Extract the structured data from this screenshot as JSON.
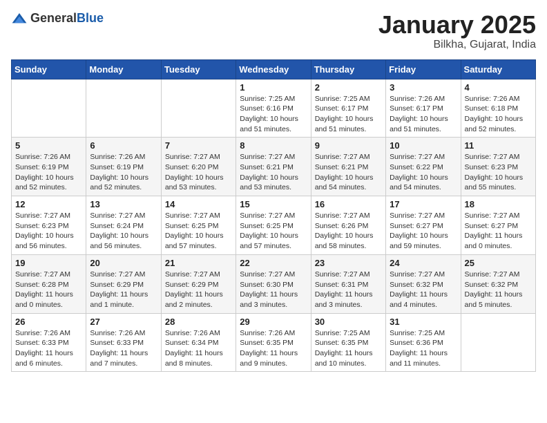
{
  "logo": {
    "general": "General",
    "blue": "Blue"
  },
  "header": {
    "month": "January 2025",
    "location": "Bilkha, Gujarat, India"
  },
  "weekdays": [
    "Sunday",
    "Monday",
    "Tuesday",
    "Wednesday",
    "Thursday",
    "Friday",
    "Saturday"
  ],
  "weeks": [
    [
      {
        "day": "",
        "info": ""
      },
      {
        "day": "",
        "info": ""
      },
      {
        "day": "",
        "info": ""
      },
      {
        "day": "1",
        "info": "Sunrise: 7:25 AM\nSunset: 6:16 PM\nDaylight: 10 hours\nand 51 minutes."
      },
      {
        "day": "2",
        "info": "Sunrise: 7:25 AM\nSunset: 6:17 PM\nDaylight: 10 hours\nand 51 minutes."
      },
      {
        "day": "3",
        "info": "Sunrise: 7:26 AM\nSunset: 6:17 PM\nDaylight: 10 hours\nand 51 minutes."
      },
      {
        "day": "4",
        "info": "Sunrise: 7:26 AM\nSunset: 6:18 PM\nDaylight: 10 hours\nand 52 minutes."
      }
    ],
    [
      {
        "day": "5",
        "info": "Sunrise: 7:26 AM\nSunset: 6:19 PM\nDaylight: 10 hours\nand 52 minutes."
      },
      {
        "day": "6",
        "info": "Sunrise: 7:26 AM\nSunset: 6:19 PM\nDaylight: 10 hours\nand 52 minutes."
      },
      {
        "day": "7",
        "info": "Sunrise: 7:27 AM\nSunset: 6:20 PM\nDaylight: 10 hours\nand 53 minutes."
      },
      {
        "day": "8",
        "info": "Sunrise: 7:27 AM\nSunset: 6:21 PM\nDaylight: 10 hours\nand 53 minutes."
      },
      {
        "day": "9",
        "info": "Sunrise: 7:27 AM\nSunset: 6:21 PM\nDaylight: 10 hours\nand 54 minutes."
      },
      {
        "day": "10",
        "info": "Sunrise: 7:27 AM\nSunset: 6:22 PM\nDaylight: 10 hours\nand 54 minutes."
      },
      {
        "day": "11",
        "info": "Sunrise: 7:27 AM\nSunset: 6:23 PM\nDaylight: 10 hours\nand 55 minutes."
      }
    ],
    [
      {
        "day": "12",
        "info": "Sunrise: 7:27 AM\nSunset: 6:23 PM\nDaylight: 10 hours\nand 56 minutes."
      },
      {
        "day": "13",
        "info": "Sunrise: 7:27 AM\nSunset: 6:24 PM\nDaylight: 10 hours\nand 56 minutes."
      },
      {
        "day": "14",
        "info": "Sunrise: 7:27 AM\nSunset: 6:25 PM\nDaylight: 10 hours\nand 57 minutes."
      },
      {
        "day": "15",
        "info": "Sunrise: 7:27 AM\nSunset: 6:25 PM\nDaylight: 10 hours\nand 57 minutes."
      },
      {
        "day": "16",
        "info": "Sunrise: 7:27 AM\nSunset: 6:26 PM\nDaylight: 10 hours\nand 58 minutes."
      },
      {
        "day": "17",
        "info": "Sunrise: 7:27 AM\nSunset: 6:27 PM\nDaylight: 10 hours\nand 59 minutes."
      },
      {
        "day": "18",
        "info": "Sunrise: 7:27 AM\nSunset: 6:27 PM\nDaylight: 11 hours\nand 0 minutes."
      }
    ],
    [
      {
        "day": "19",
        "info": "Sunrise: 7:27 AM\nSunset: 6:28 PM\nDaylight: 11 hours\nand 0 minutes."
      },
      {
        "day": "20",
        "info": "Sunrise: 7:27 AM\nSunset: 6:29 PM\nDaylight: 11 hours\nand 1 minute."
      },
      {
        "day": "21",
        "info": "Sunrise: 7:27 AM\nSunset: 6:29 PM\nDaylight: 11 hours\nand 2 minutes."
      },
      {
        "day": "22",
        "info": "Sunrise: 7:27 AM\nSunset: 6:30 PM\nDaylight: 11 hours\nand 3 minutes."
      },
      {
        "day": "23",
        "info": "Sunrise: 7:27 AM\nSunset: 6:31 PM\nDaylight: 11 hours\nand 3 minutes."
      },
      {
        "day": "24",
        "info": "Sunrise: 7:27 AM\nSunset: 6:32 PM\nDaylight: 11 hours\nand 4 minutes."
      },
      {
        "day": "25",
        "info": "Sunrise: 7:27 AM\nSunset: 6:32 PM\nDaylight: 11 hours\nand 5 minutes."
      }
    ],
    [
      {
        "day": "26",
        "info": "Sunrise: 7:26 AM\nSunset: 6:33 PM\nDaylight: 11 hours\nand 6 minutes."
      },
      {
        "day": "27",
        "info": "Sunrise: 7:26 AM\nSunset: 6:33 PM\nDaylight: 11 hours\nand 7 minutes."
      },
      {
        "day": "28",
        "info": "Sunrise: 7:26 AM\nSunset: 6:34 PM\nDaylight: 11 hours\nand 8 minutes."
      },
      {
        "day": "29",
        "info": "Sunrise: 7:26 AM\nSunset: 6:35 PM\nDaylight: 11 hours\nand 9 minutes."
      },
      {
        "day": "30",
        "info": "Sunrise: 7:25 AM\nSunset: 6:35 PM\nDaylight: 11 hours\nand 10 minutes."
      },
      {
        "day": "31",
        "info": "Sunrise: 7:25 AM\nSunset: 6:36 PM\nDaylight: 11 hours\nand 11 minutes."
      },
      {
        "day": "",
        "info": ""
      }
    ]
  ]
}
